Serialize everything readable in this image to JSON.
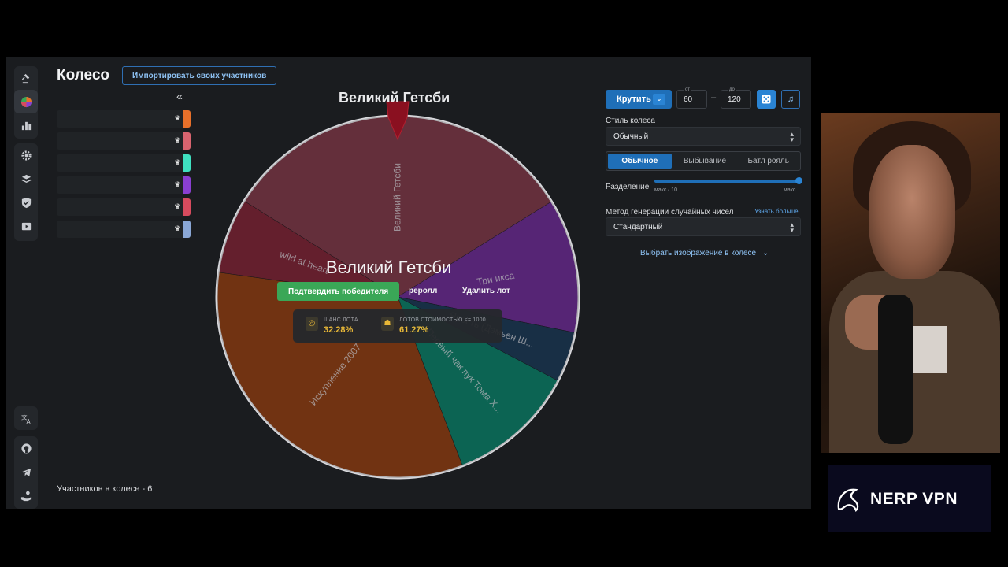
{
  "app": {
    "title": "Колесо",
    "import_button": "Импортировать своих участников",
    "collapse_glyph": "«",
    "participant_colors": [
      "#e8702a",
      "#d9646f",
      "#3fe0c0",
      "#8a3fd1",
      "#d74b5e",
      "#8aa7d6"
    ],
    "participants_count": "Участников в колесе - 6"
  },
  "sidebar": {
    "top_icons": [
      "gavel-icon",
      "wheel-icon",
      "bar-chart-icon"
    ],
    "mid_icons": [
      "gear-icon",
      "layers-icon",
      "shield-icon",
      "playlist-icon"
    ],
    "bottom_icons": [
      "translate-icon",
      "github-icon",
      "telegram-icon",
      "donate-icon"
    ]
  },
  "wheel": {
    "title": "Великий Гетсби",
    "slices": [
      {
        "label": "Великий Гетсби",
        "percent": 32.28,
        "color": "#7a3a48"
      },
      {
        "label": "Три икса",
        "percent": 12.0,
        "color": "#6a2e8f"
      },
      {
        "label": "Ярость (Дэмьен Ш...",
        "percent": 4.5,
        "color": "#1e3a55"
      },
      {
        "label": "Первый чак пук Тома Х...",
        "percent": 11.5,
        "color": "#0f7a66"
      },
      {
        "label": "Искупление 2007",
        "percent": 33.0,
        "color": "#8a3f17"
      },
      {
        "label": "wild at heart",
        "percent": 6.72,
        "color": "#7a2638"
      }
    ],
    "winner": "Великий Гетсби",
    "confirm_button": "Подтвердить победителя",
    "reroll_button": "реролл",
    "delete_button": "Удалить лот",
    "chance_label": "ШАНС ЛОТА",
    "chance_value": "32.28%",
    "cost_label": "ЛОТОВ СТОИМОСТЬЮ <= 1000",
    "cost_value": "61.27%"
  },
  "controls": {
    "spin_button": "Крутить",
    "spin_chevron": "⌄",
    "from_caption": "от",
    "from_value": "60",
    "to_caption": "до",
    "to_value": "120",
    "range_dash": "–",
    "dice_icon": "dice-icon",
    "music_icon": "music-icon",
    "style_label": "Стиль колеса",
    "style_value": "Обычный",
    "mode_tabs": [
      "Обычное",
      "Выбывание",
      "Батл рояль"
    ],
    "split_label": "Разделение",
    "split_min": "макс / 10",
    "split_max": "макс",
    "split_fraction": 1.0,
    "rng_label": "Метод генерации случайных чисел",
    "rng_link": "Узнать больше",
    "rng_value": "Стандартный",
    "image_link": "Выбрать изображение в колесе",
    "accent": "#1f6fb8"
  },
  "ad": {
    "brand": "NERP VPN"
  }
}
